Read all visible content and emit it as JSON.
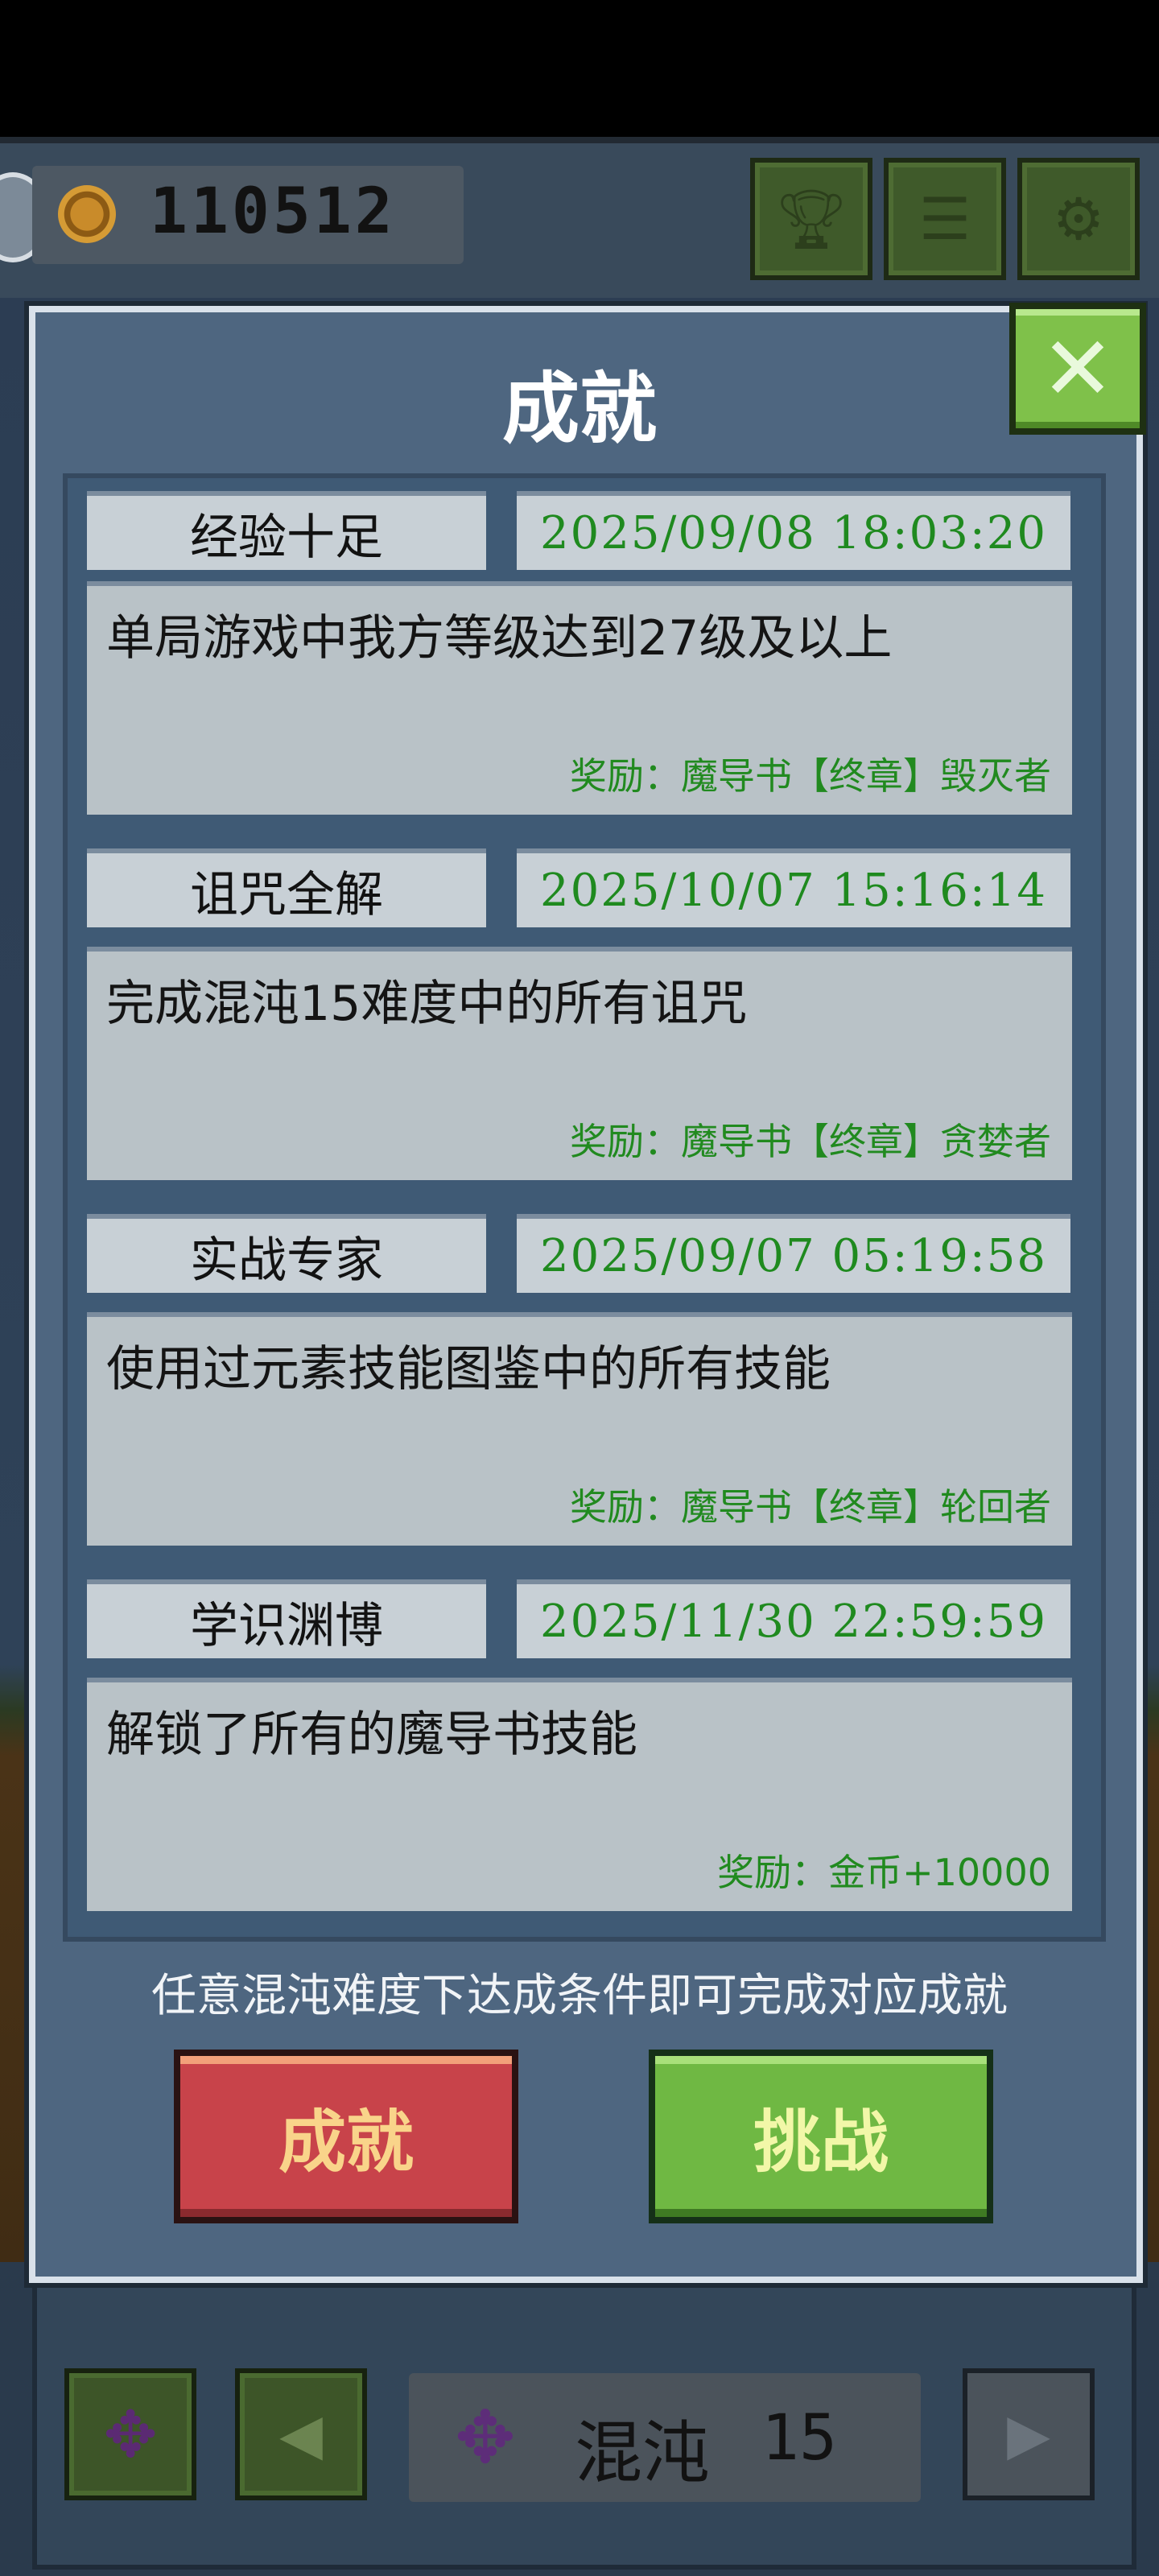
{
  "hud": {
    "coins": "110512",
    "buttons": [
      {
        "name": "trophy-icon"
      },
      {
        "name": "list-icon"
      },
      {
        "name": "settings-gear-icon"
      }
    ]
  },
  "dialog": {
    "title": "成就",
    "close_icon": "close-x-icon",
    "achievements": [
      {
        "name": "经验十足",
        "time": "2025/09/08 18:03:20",
        "desc": "单局游戏中我方等级达到27级及以上",
        "reward": "奖励：魔导书【终章】毁灭者"
      },
      {
        "name": "诅咒全解",
        "time": "2025/10/07 15:16:14",
        "desc": "完成混沌15难度中的所有诅咒",
        "reward": "奖励：魔导书【终章】贪婪者"
      },
      {
        "name": "实战专家",
        "time": "2025/09/07 05:19:58",
        "desc": "使用过元素技能图鉴中的所有技能",
        "reward": "奖励：魔导书【终章】轮回者"
      },
      {
        "name": "学识渊博",
        "time": "2025/11/30 22:59:59",
        "desc": "解锁了所有的魔导书技能",
        "reward": "奖励：金币+10000"
      }
    ],
    "hint": "任意混沌难度下达成条件即可完成对应成就",
    "buttons": {
      "achievements": "成就",
      "challenge": "挑战"
    }
  },
  "bottom": {
    "difficulty_label": "混沌",
    "difficulty_level": "15"
  },
  "colors": {
    "accent_green": "#7fc14a",
    "accent_red": "#c8434a",
    "date_green": "#1f8a1f"
  }
}
